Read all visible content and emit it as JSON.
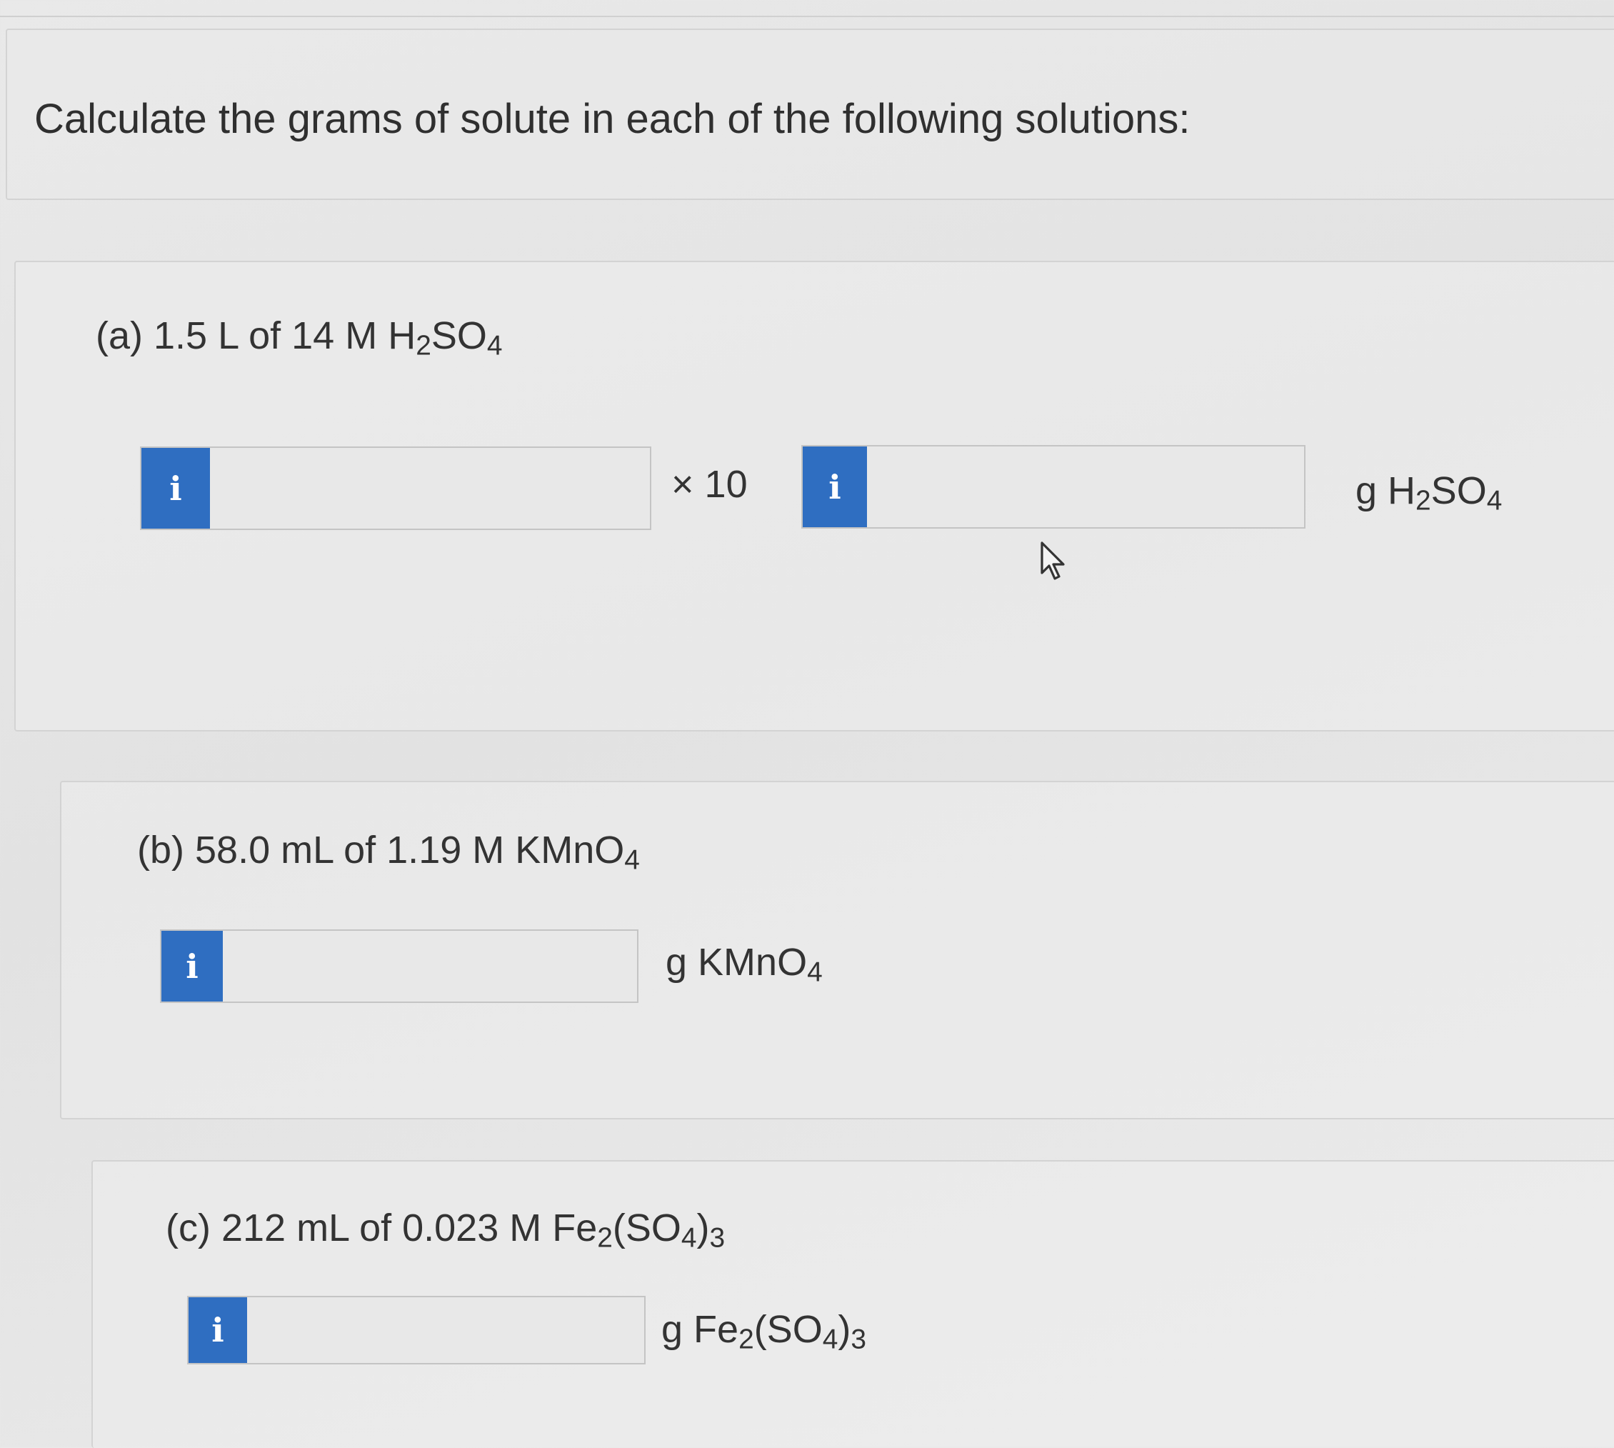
{
  "prompt": "Calculate the grams of solute in each of the following solutions:",
  "parts": {
    "a": {
      "label": "(a) 1.5 L of 14 M H",
      "sub1": "2",
      "mid": "SO",
      "sub2": "4",
      "times_label": "× 10",
      "unit_pre": "g H",
      "unit_sub1": "2",
      "unit_mid": "SO",
      "unit_sub2": "4",
      "mantissa_value": "",
      "exponent_value": ""
    },
    "b": {
      "label": "(b) 58.0 mL of 1.19 M KMnO",
      "sub1": "4",
      "unit_pre": "g KMnO",
      "unit_sub1": "4",
      "value": ""
    },
    "c": {
      "label": "(c) 212 mL of 0.023 M Fe",
      "sub1": "2",
      "mid": "(SO",
      "sub2": "4",
      "tail": ")",
      "sub3": "3",
      "unit_pre": "g Fe",
      "unit_sub1": "2",
      "unit_mid": "(SO",
      "unit_sub2": "4",
      "unit_tail": ")",
      "unit_sub3": "3",
      "value": ""
    }
  },
  "info_glyph": "i",
  "colors": {
    "info_badge": "#2f6ec1",
    "background": "#e6e6e6"
  },
  "icons": {
    "info": "info-icon",
    "cursor": "mouse-pointer-icon"
  }
}
